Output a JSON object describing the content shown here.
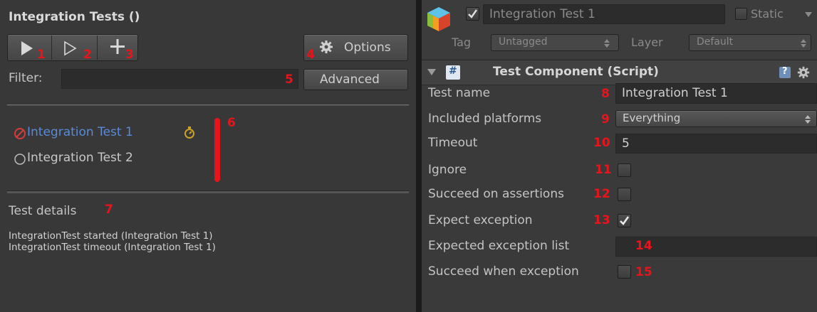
{
  "left": {
    "title": "Integration Tests ()",
    "toolbar": {
      "run_all_icon": "play-filled-icon",
      "run_selected_icon": "play-outline-icon",
      "add_icon": "plus-icon",
      "options_label": "Options",
      "options_icon": "gear-icon"
    },
    "filter_label": "Filter:",
    "filter_value": "",
    "advanced_label": "Advanced",
    "tests": [
      {
        "name": "Integration Test 1",
        "status": "failed",
        "status_color": "#d23c3c",
        "name_color": "#5a8ad8",
        "timeout_icon": "stopwatch-icon"
      },
      {
        "name": "Integration Test 2",
        "status": "not-run",
        "name_color": "#c8c8c8"
      }
    ],
    "details_title": "Test details",
    "log_lines": [
      "IntegrationTest started (Integration Test 1)",
      "IntegrationTest timeout (Integration Test 1)"
    ]
  },
  "right": {
    "header": {
      "object_icon": "cube-icon",
      "active_checked": true,
      "object_name": "Integration Test 1",
      "static_label": "Static",
      "tag_label": "Tag",
      "tag_value": "Untagged",
      "layer_label": "Layer",
      "layer_value": "Default"
    },
    "component": {
      "title": "Test Component (Script)",
      "script_icon": "csharp-script-icon",
      "help_icon": "help-icon",
      "settings_icon": "gear-icon"
    },
    "fields": {
      "test_name_label": "Test name",
      "test_name_value": "Integration Test 1",
      "platforms_label": "Included platforms",
      "platforms_value": "Everything",
      "timeout_label": "Timeout",
      "timeout_value": "5",
      "ignore_label": "Ignore",
      "ignore_checked": false,
      "succeed_assertions_label": "Succeed on assertions",
      "succeed_assertions_checked": false,
      "expect_exception_label": "Expect exception",
      "expect_exception_checked": true,
      "expected_list_label": "Expected exception list",
      "expected_list_value": "",
      "succeed_exception_label": "Succeed when exception",
      "succeed_exception_checked": false
    }
  },
  "markers": [
    "1",
    "2",
    "3",
    "4",
    "5",
    "6",
    "7",
    "8",
    "9",
    "10",
    "11",
    "12",
    "13",
    "14",
    "15"
  ],
  "colors": {
    "marker": "#e8141c",
    "panel": "#383838",
    "failed": "#d23c3c",
    "link": "#5a8ad8"
  }
}
